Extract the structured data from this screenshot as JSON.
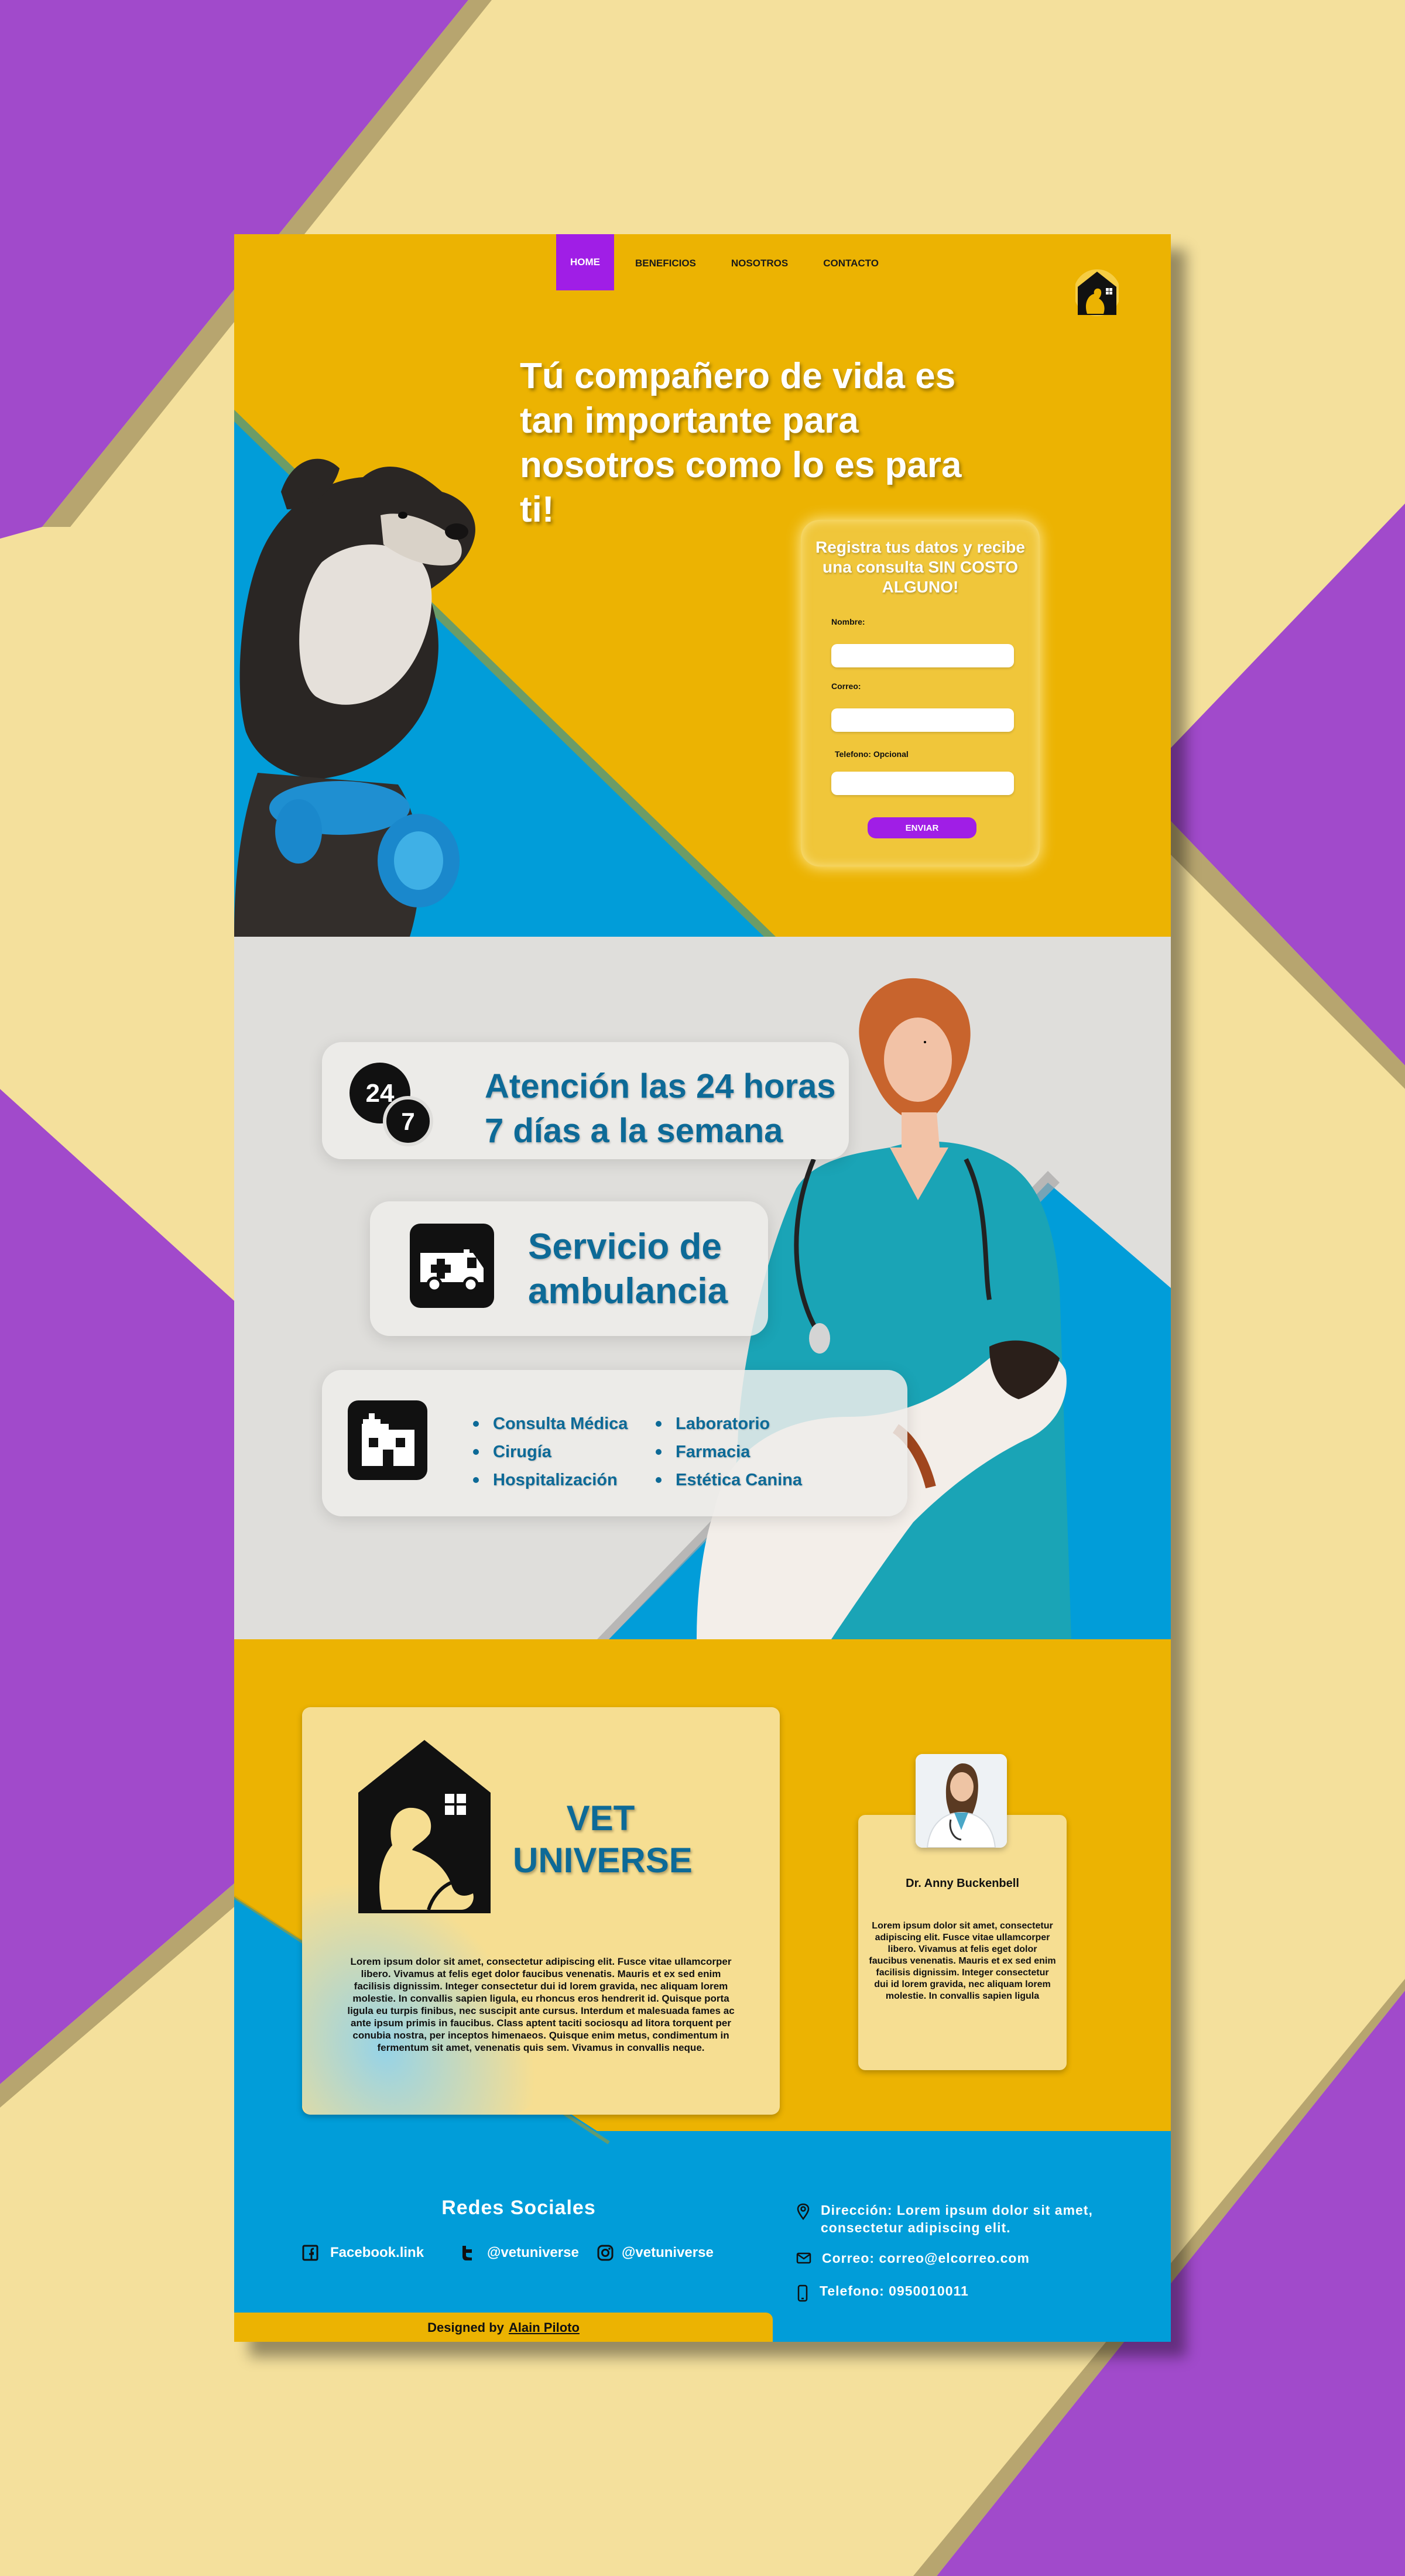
{
  "nav": {
    "items": [
      {
        "label": "HOME",
        "active": true
      },
      {
        "label": "BENEFICIOS",
        "active": false
      },
      {
        "label": "NOSOTROS",
        "active": false
      },
      {
        "label": "CONTACTO",
        "active": false
      }
    ]
  },
  "hero": {
    "headline": "Tú compañero de vida es tan importante para nosotros como lo es para ti!"
  },
  "form": {
    "title": "Registra tus datos y recibe una consulta SIN COSTO ALGUNO!",
    "name_label": "Nombre:",
    "email_label": "Correo:",
    "phone_label": "Telefono: Opcional",
    "submit_label": "ENVIAR"
  },
  "services": {
    "hours_badge_top": "24",
    "hours_badge_bottom": "7",
    "hours_line1": "Atención las 24 horas",
    "hours_line2": "7 días a la semana",
    "ambulance_line1": "Servicio de",
    "ambulance_line2": "ambulancia",
    "list_left": [
      "Consulta Médica",
      "Cirugía",
      "Hospitalización"
    ],
    "list_right": [
      "Laboratorio",
      "Farmacia",
      "Estética Canina"
    ]
  },
  "about": {
    "title": "VET UNIVERSE",
    "text": "Lorem ipsum dolor sit amet, consectetur adipiscing elit. Fusce vitae ullamcorper libero. Vivamus at felis eget dolor faucibus venenatis. Mauris et ex sed enim facilisis dignissim. Integer consectetur dui id lorem gravida, nec aliquam lorem molestie. In convallis sapien ligula, eu rhoncus eros hendrerit id. Quisque porta ligula eu turpis finibus, nec suscipit ante cursus. Interdum et malesuada fames ac ante ipsum primis in faucibus. Class aptent taciti sociosqu ad litora torquent per conubia nostra, per inceptos himenaeos. Quisque enim metus, condimentum in fermentum sit amet, venenatis quis sem. Vivamus in convallis neque."
  },
  "doctor": {
    "name": "Dr. Anny Buckenbell",
    "text": "Lorem ipsum dolor sit amet, consectetur adipiscing elit. Fusce vitae ullamcorper libero. Vivamus at felis eget dolor faucibus venenatis. Mauris et ex sed enim facilisis dignissim. Integer consectetur dui id lorem gravida, nec aliquam lorem molestie. In convallis sapien ligula"
  },
  "footer": {
    "social_title": "Redes Sociales",
    "facebook": "Facebook.link",
    "twitter": "@vetuniverse",
    "instagram": "@vetuniverse",
    "address": "Dirección:  Lorem ipsum dolor sit amet,\n consectetur adipiscing elit.",
    "email": "Correo: correo@elcorreo.com",
    "phone": "Telefono: 0950010011",
    "credit_prefix": "Designed by",
    "credit_name": "Alain Piloto"
  },
  "colors": {
    "purple": "#a01ee6",
    "gold": "#ecb302",
    "blue": "#019dd9",
    "teal_text": "#0d6a97",
    "cream": "#f4e09c"
  },
  "icons": [
    "logo-icon",
    "24-7-icon",
    "ambulance-icon",
    "hospital-icon",
    "facebook-icon",
    "twitter-icon",
    "instagram-icon",
    "location-icon",
    "mail-icon",
    "phone-icon"
  ]
}
